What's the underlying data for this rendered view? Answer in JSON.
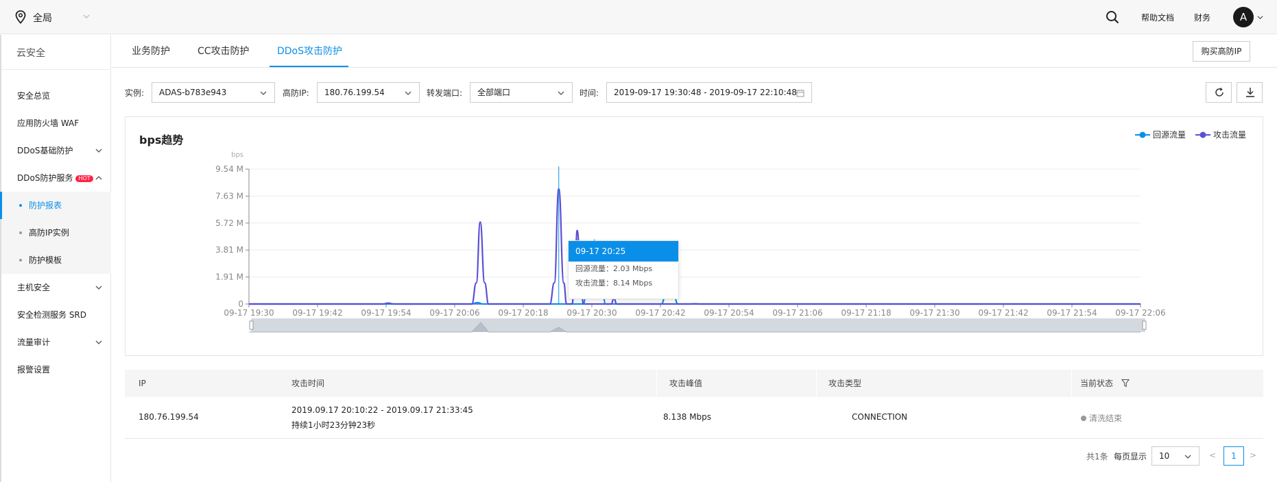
{
  "topbar": {
    "region": "全局",
    "links": [
      "帮助文档",
      "财务"
    ],
    "avatar_letter": "A"
  },
  "sidebar": {
    "title": "云安全",
    "items": [
      {
        "label": "安全总览",
        "expandable": false
      },
      {
        "label": "应用防火墙 WAF",
        "expandable": false
      },
      {
        "label": "DDoS基础防护",
        "expandable": true
      },
      {
        "label": "DDoS防护服务",
        "expandable": true,
        "badge": "HOT",
        "expanded": true
      },
      {
        "label": "主机安全",
        "expandable": true
      },
      {
        "label": "安全检测服务 SRD",
        "expandable": false
      },
      {
        "label": "流量审计",
        "expandable": true
      },
      {
        "label": "报警设置",
        "expandable": false
      }
    ],
    "subitems": [
      {
        "label": "防护报表",
        "active": true
      },
      {
        "label": "高防IP实例",
        "active": false
      },
      {
        "label": "防护模板",
        "active": false
      }
    ]
  },
  "tabs": {
    "items": [
      "业务防护",
      "CC攻击防护",
      "DDoS攻击防护"
    ],
    "active": "DDoS攻击防护",
    "buy_button": "购买高防IP"
  },
  "filters": {
    "instance_label": "实例:",
    "instance_value": "ADAS-b783e943",
    "ip_label": "高防IP:",
    "ip_value": "180.76.199.54",
    "port_label": "转发端口:",
    "port_value": "全部端口",
    "time_label": "时间:",
    "time_value": "2019-09-17 19:30:48 - 2019-09-17 22:10:48"
  },
  "chart_data": {
    "type": "line",
    "title": "bps趋势",
    "ylabel": "bps",
    "yticks": [
      "0",
      "1.91 M",
      "3.81 M",
      "5.72 M",
      "7.63 M",
      "9.54 M"
    ],
    "ylim": [
      0,
      9.54
    ],
    "xticks": [
      "09-17 19:30",
      "09-17 19:42",
      "09-17 19:54",
      "09-17 20:06",
      "09-17 20:18",
      "09-17 20:30",
      "09-17 20:42",
      "09-17 20:54",
      "09-17 21:06",
      "09-17 21:18",
      "09-17 21:30",
      "09-17 21:42",
      "09-17 21:54",
      "09-17 22:06"
    ],
    "x_minutes_range": [
      0,
      160
    ],
    "legend_position": "top-right",
    "grid": true,
    "series": [
      {
        "name": "回源流量",
        "color": "#0a8fe8",
        "points": [
          [
            0,
            0
          ],
          [
            40,
            0
          ],
          [
            41,
            0.1
          ],
          [
            42,
            0
          ],
          [
            60,
            0
          ],
          [
            61,
            3.1
          ],
          [
            62,
            4.5
          ],
          [
            63,
            3.1
          ],
          [
            64,
            0
          ],
          [
            74,
            0
          ],
          [
            75,
            1.0
          ],
          [
            75.5,
            2.0
          ],
          [
            76,
            1.0
          ],
          [
            77,
            0
          ],
          [
            79,
            0
          ],
          [
            80,
            0.02
          ],
          [
            81,
            0
          ],
          [
            160,
            0
          ]
        ]
      },
      {
        "name": "攻击流量",
        "color": "#5b4fd4",
        "points": [
          [
            0,
            0
          ],
          [
            24,
            0
          ],
          [
            25,
            0.06
          ],
          [
            26,
            0
          ],
          [
            40,
            0
          ],
          [
            40.8,
            1.5
          ],
          [
            41.5,
            5.8
          ],
          [
            42.3,
            1.5
          ],
          [
            43,
            0
          ],
          [
            54,
            0
          ],
          [
            54.8,
            1.5
          ],
          [
            55.6,
            8.14
          ],
          [
            56.5,
            1.5
          ],
          [
            57,
            0
          ],
          [
            58,
            0
          ],
          [
            58.5,
            2.5
          ],
          [
            58.9,
            5.2
          ],
          [
            59.5,
            2.5
          ],
          [
            60,
            0
          ],
          [
            65,
            0
          ],
          [
            65.5,
            0.4
          ],
          [
            66,
            0
          ],
          [
            160,
            0
          ]
        ]
      }
    ],
    "crosshair_x": 55.6
  },
  "tooltip": {
    "time": "09-17 20:25",
    "rows": [
      {
        "label": "回源流量：",
        "value": "2.03 Mbps"
      },
      {
        "label": "攻击流量：",
        "value": "8.14 Mbps"
      }
    ]
  },
  "table": {
    "headers": [
      "IP",
      "攻击时间",
      "攻击峰值",
      "攻击类型",
      "当前状态"
    ],
    "rows": [
      {
        "ip": "180.76.199.54",
        "time": "2019.09.17 20:10:22 - 2019.09.17 21:33:45",
        "duration": "持续1小时23分钟23秒",
        "peak": "8.138 Mbps",
        "type": "CONNECTION",
        "status": "清洗结束"
      }
    ]
  },
  "pagination": {
    "total": "共1条",
    "per_page_label": "每页显示",
    "per_page": "10",
    "prev": "<",
    "next": ">",
    "current": "1"
  }
}
